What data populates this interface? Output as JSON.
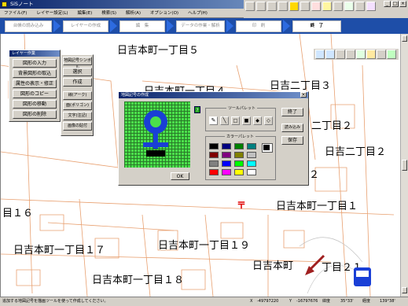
{
  "window": {
    "title": "SiSノート"
  },
  "menu": [
    "ファイル(F)",
    "レイヤー設定(L)",
    "編集(E)",
    "検索(S)",
    "解析(A)",
    "オプション(O)",
    "ヘルプ(H)"
  ],
  "steps": [
    "台帳の読み込み",
    "レイヤーの作成",
    "編　集",
    "データの作業・解析",
    "印　刷",
    "終　了"
  ],
  "map_labels": [
    "日吉本町一丁目５",
    "日吉本町一丁目４",
    "日吉二丁目３",
    "二丁目２",
    "日吉二丁目２",
    "２",
    "日吉本町一丁目１",
    "目１６",
    "日吉本町一丁目１９",
    "日吉本町一丁目１７",
    "日吉本町",
    "丁目２１",
    "日吉本町一丁目１８"
  ],
  "layer_panel": {
    "title": "レイヤー作業",
    "buttons": [
      "図形の入力",
      "背景図形の取込",
      "属性の表示・修正",
      "図形のコピー",
      "図形の移動",
      "図形の削除"
    ]
  },
  "draw_panel": {
    "buttons": [
      "地図記号シンボル",
      "選択",
      "作成",
      "線(アーク)",
      "面(ポリゴン)",
      "文字(注記)",
      "画像の貼付"
    ]
  },
  "dialog": {
    "title": "地図記号の作成",
    "tool_palette_label": "ツールパレット",
    "color_palette_label": "カラーパレット",
    "buttons": {
      "finish": "終了",
      "load": "読み込み",
      "save": "保存",
      "ok": "OK"
    },
    "colors": [
      "#000000",
      "#000080",
      "#008000",
      "#008080",
      "#800000",
      "#800080",
      "#808000",
      "#c0c0c0",
      "#808080",
      "#0000ff",
      "#00ff00",
      "#00ffff",
      "#ff0000",
      "#ff00ff",
      "#ffff00",
      "#ffffff"
    ],
    "current_color": "#000000",
    "help_icon": "?"
  },
  "status": {
    "message": "追加する地図記号を描画ツールを使って作成してください。",
    "x_label": "X",
    "x_value": "-49797220",
    "y_label": "Y",
    "y_value": "-16797676",
    "lat_label": "緯度",
    "lat_value": "35°33'",
    "lon_label": "経度",
    "lon_value": "139°38'"
  }
}
